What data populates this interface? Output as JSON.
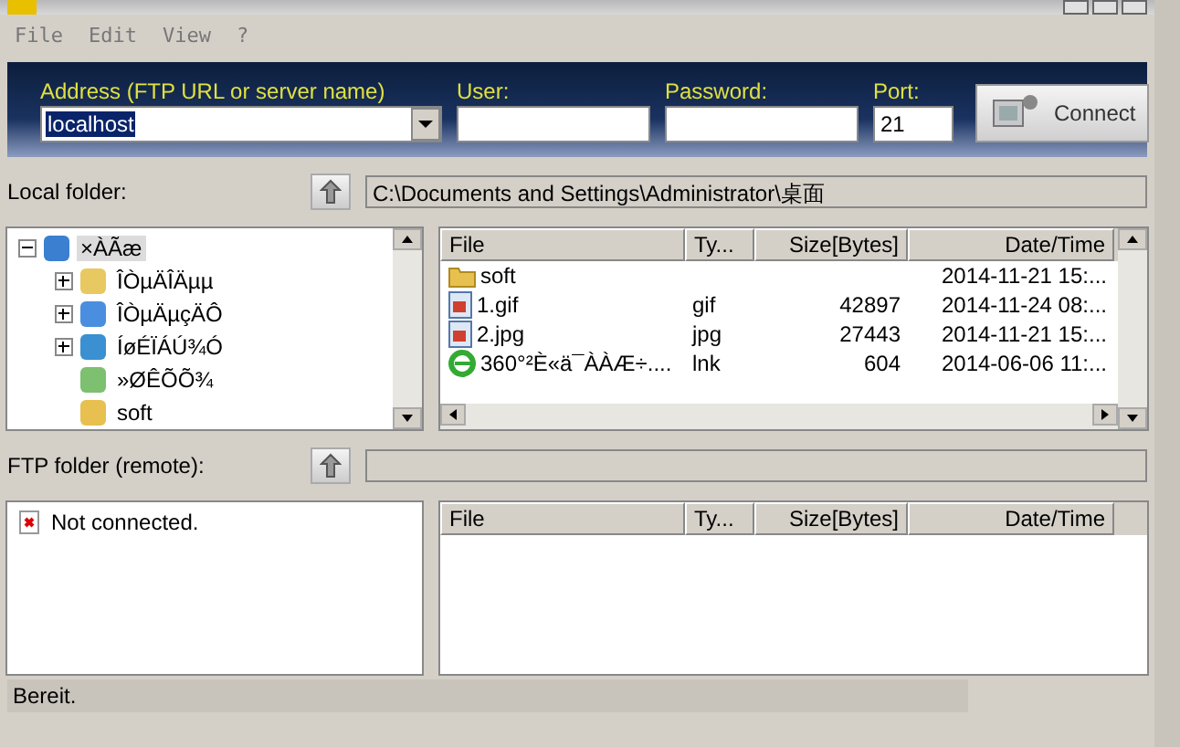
{
  "menu": [
    {
      "label": "File"
    },
    {
      "label": "Edit"
    },
    {
      "label": "View"
    },
    {
      "label": "?"
    }
  ],
  "connection": {
    "address_label": "Address (FTP URL or server name)",
    "address_value": "localhost",
    "user_label": "User:",
    "password_label": "Password:",
    "port_label": "Port:",
    "port_value": "21",
    "connect_button": "Connect"
  },
  "local_folder": {
    "label": "Local folder:",
    "path": "C:\\Documents and Settings\\Administrator\\桌面",
    "tree": [
      {
        "label": "×ÀÃæ",
        "kind": "desktop",
        "selected": true,
        "expanded": true,
        "children": [
          {
            "label": "ÎÒµÄÎÄµµ",
            "kind": "documents",
            "selected": false,
            "expanded": false
          },
          {
            "label": "ÎÒµÄµçÄÔ",
            "kind": "computer",
            "selected": false,
            "expanded": false
          },
          {
            "label": "ÍøÉÏÁÚ¾Ó",
            "kind": "network",
            "selected": false,
            "expanded": false
          },
          {
            "label": "»ØÊÕÕ¾",
            "kind": "recycle",
            "selected": false
          },
          {
            "label": "soft",
            "kind": "folder",
            "selected": false
          }
        ]
      }
    ],
    "columns": [
      "File",
      "Ty...",
      "Size[Bytes]",
      "Date/Time"
    ],
    "rows": [
      {
        "kind": "folder",
        "name": "soft",
        "type": "",
        "size": "",
        "date": "2014-11-21 15:..."
      },
      {
        "kind": "image",
        "name": "1.gif",
        "type": "gif",
        "size": "42897",
        "date": "2014-11-24 08:..."
      },
      {
        "kind": "image",
        "name": "2.jpg",
        "type": "jpg",
        "size": "27443",
        "date": "2014-11-21 15:..."
      },
      {
        "kind": "shortcut",
        "name": "360°²È«ä¯ÀÀÆ÷....",
        "type": "lnk",
        "size": "604",
        "date": "2014-06-06 11:..."
      }
    ]
  },
  "remote_folder": {
    "label": "FTP folder (remote):",
    "status": "Not connected.",
    "columns": [
      "File",
      "Ty...",
      "Size[Bytes]",
      "Date/Time"
    ]
  },
  "status_bar": "Bereit."
}
